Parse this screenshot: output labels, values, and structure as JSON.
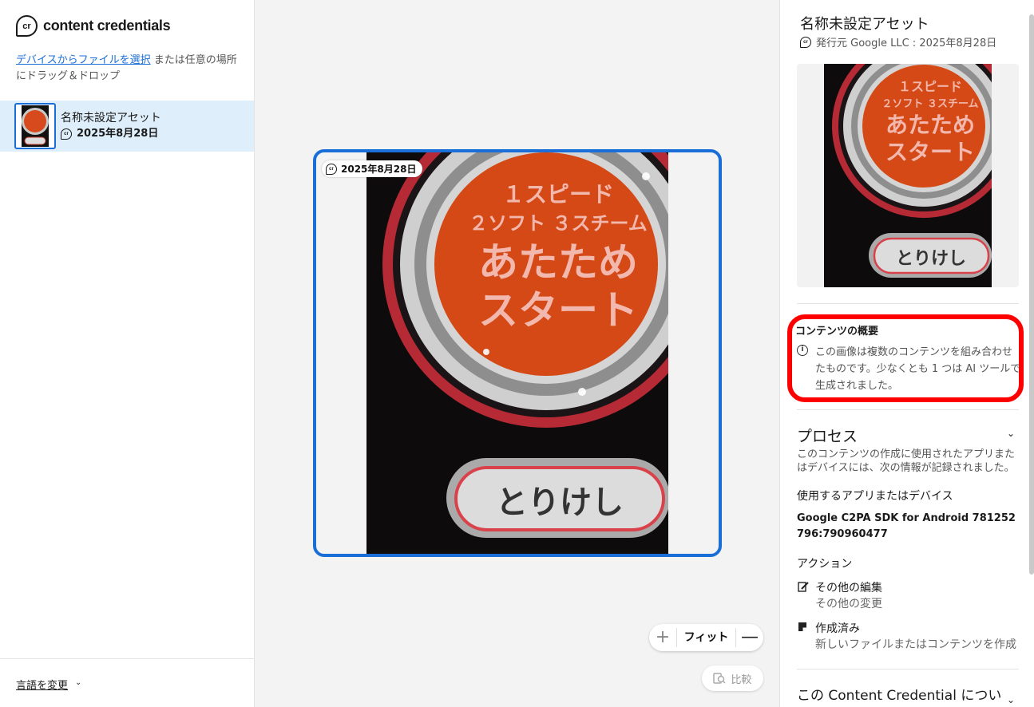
{
  "app": {
    "brand": "content credentials",
    "brand_icon": "cr-logo-icon"
  },
  "sidebar": {
    "upload_link": "デバイスからファイルを選択",
    "upload_rest": " または任意の場所にドラッグ＆ドロップ",
    "asset": {
      "title": "名称未設定アセット",
      "date": "2025年8月28日"
    },
    "language": "言語を変更"
  },
  "viewer": {
    "badge_date": "2025年8月28日",
    "zoom": {
      "plus": "+",
      "fit": "フィット",
      "minus": "—"
    },
    "compare": "比較",
    "image": {
      "line1": "１スピード",
      "line2": "２ソフト ３スチーム",
      "line3": "あたため",
      "line4": "スタート",
      "button": "とりけし"
    }
  },
  "panel": {
    "title": "名称未設定アセット",
    "issuer": "発行元 Google LLC : 2025年8月28日",
    "summary_title": "コンテンツの概要",
    "summary_text": "この画像は複数のコンテンツを組み合わせたものです。少なくとも 1 つは AI ツールで生成されました。",
    "process": {
      "heading": "プロセス",
      "desc": "このコンテンツの作成に使用されたアプリまたはデバイスには、次の情報が記録されました。",
      "app_label": "使用するアプリまたはデバイス",
      "app_value": "Google C2PA SDK for Android 781252796:790960477",
      "actions_label": "アクション",
      "actions": [
        {
          "title": "その他の編集",
          "sub": "その他の変更"
        },
        {
          "title": "作成済み",
          "sub": "新しいファイルまたはコンテンツを作成"
        }
      ]
    },
    "about_heading": "この Content Credential につい"
  },
  "colors": {
    "accent": "#1a6ed8",
    "highlight": "#ff0000",
    "selected_bg": "#dfeefb"
  }
}
